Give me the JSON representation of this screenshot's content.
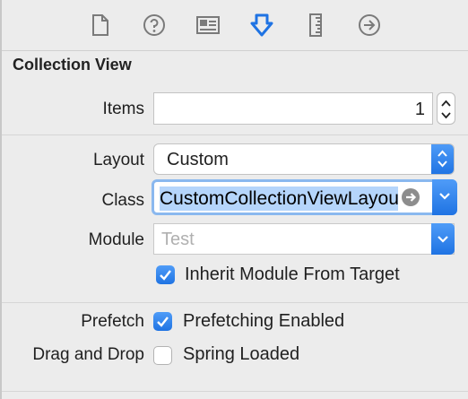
{
  "tabs": [
    {
      "name": "file-inspector",
      "icon": "document-icon"
    },
    {
      "name": "quick-help",
      "icon": "question-icon"
    },
    {
      "name": "identity-inspector",
      "icon": "identity-card-icon"
    },
    {
      "name": "attributes-inspector",
      "icon": "attributes-arrow-icon",
      "selected": true
    },
    {
      "name": "size-inspector",
      "icon": "ruler-icon"
    },
    {
      "name": "connections-inspector",
      "icon": "arrow-circle-icon"
    }
  ],
  "section": {
    "title": "Collection View"
  },
  "items": {
    "label": "Items",
    "value": "1"
  },
  "layout": {
    "label": "Layout",
    "value": "Custom"
  },
  "class": {
    "label": "Class",
    "value": "CustomCollectionViewLayout"
  },
  "module": {
    "label": "Module",
    "placeholder": "Test"
  },
  "inherit": {
    "label": "Inherit Module From Target",
    "checked": true
  },
  "prefetch": {
    "label": "Prefetch",
    "option": "Prefetching Enabled",
    "checked": true
  },
  "drag_drop": {
    "label": "Drag and Drop",
    "option": "Spring Loaded",
    "checked": false
  },
  "colors": {
    "accent": "#1f73e3",
    "selection": "#b5d5fb",
    "focus_ring": "#8ab8ef",
    "background": "#ececec"
  }
}
